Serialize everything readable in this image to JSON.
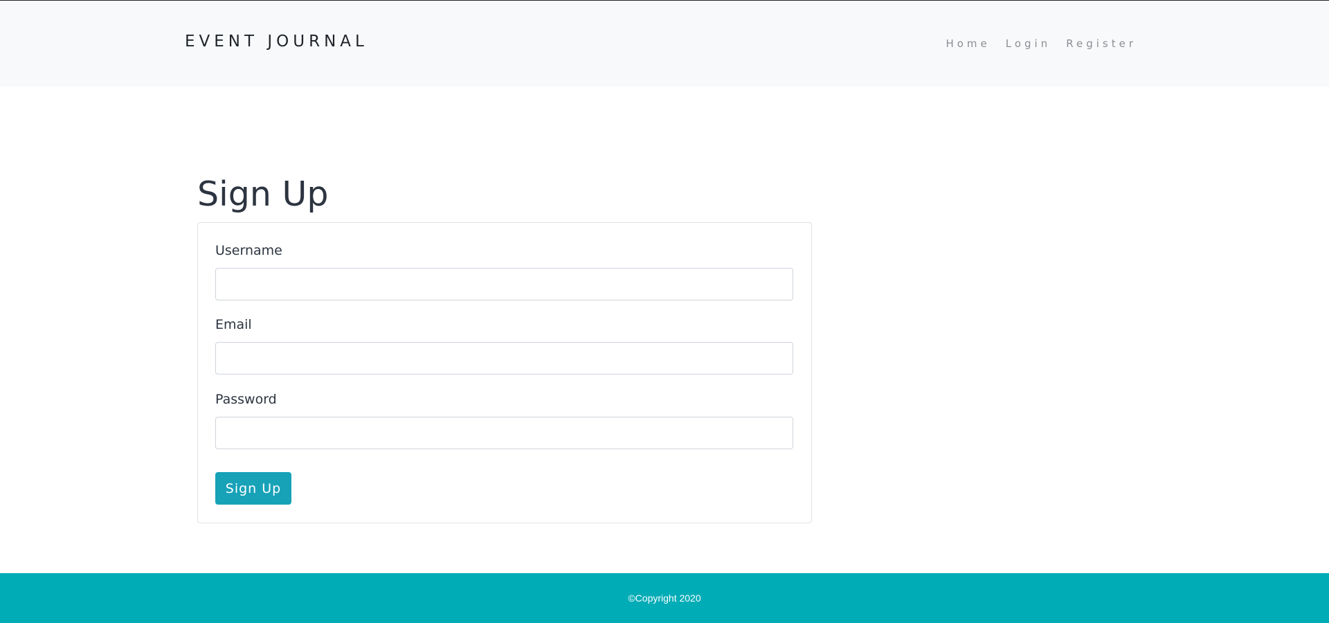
{
  "navbar": {
    "brand": "EVENT JOURNAL",
    "links": [
      {
        "label": "Home"
      },
      {
        "label": "Login"
      },
      {
        "label": "Register"
      }
    ]
  },
  "page": {
    "title": "Sign Up"
  },
  "form": {
    "username": {
      "label": "Username",
      "value": "",
      "placeholder": ""
    },
    "email": {
      "label": "Email",
      "value": "",
      "placeholder": ""
    },
    "password": {
      "label": "Password",
      "value": "",
      "placeholder": ""
    },
    "submit_label": "Sign Up"
  },
  "footer": {
    "text": "©Copyright 2020"
  },
  "colors": {
    "navbar_bg": "#f8f9fa",
    "button_bg": "#17a2b8",
    "footer_bg": "#00acb6"
  }
}
